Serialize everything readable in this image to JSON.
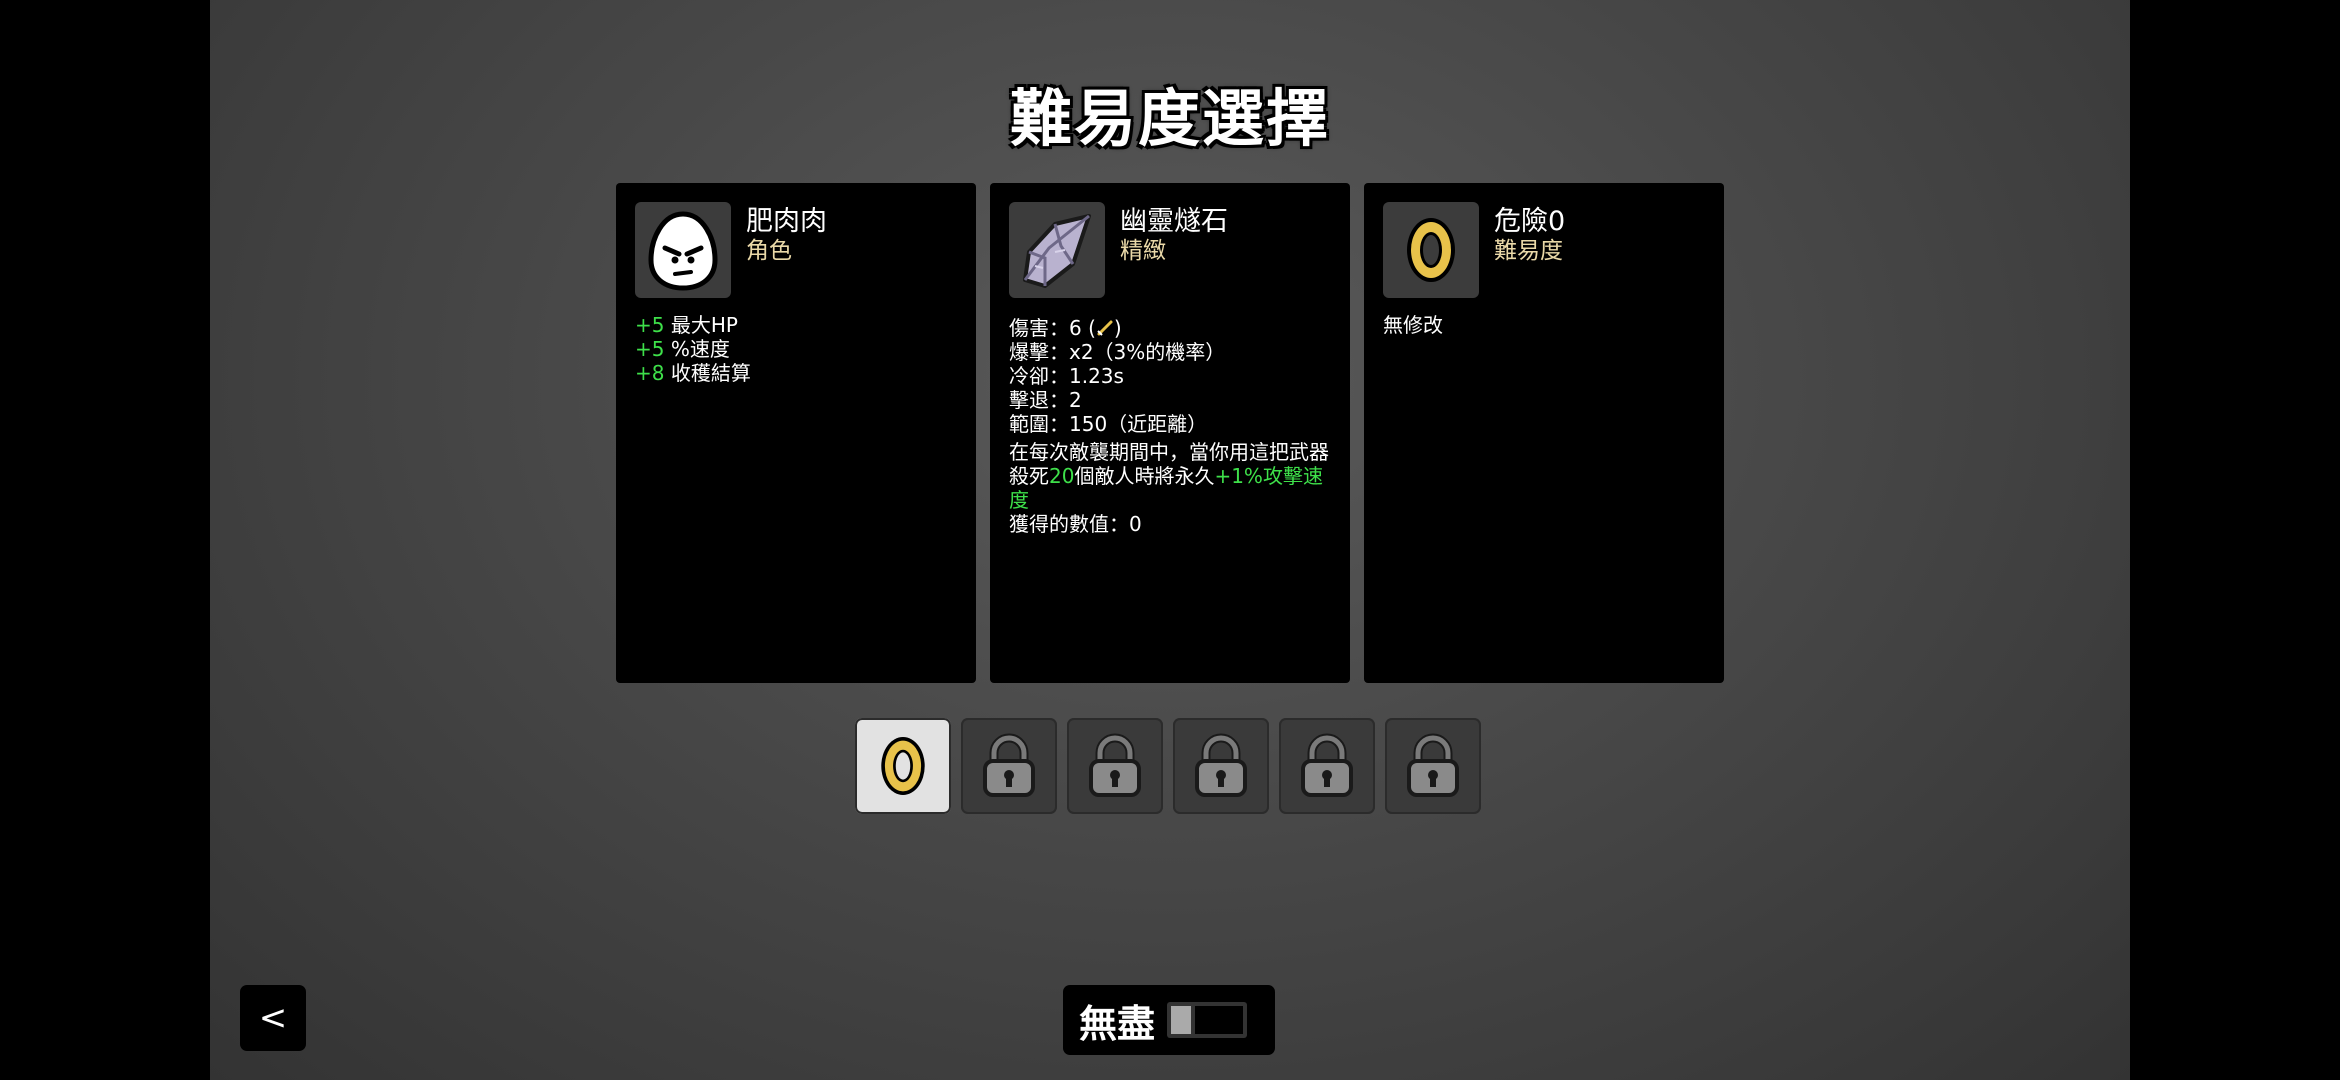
{
  "page_title": "難易度選擇",
  "cards": {
    "character": {
      "name": "肥肉肉",
      "type": "角色",
      "stats": [
        {
          "value": "+5",
          "label": "最大HP"
        },
        {
          "value": "+5",
          "label": "%速度"
        },
        {
          "value": "+8",
          "label": "收穫結算"
        }
      ]
    },
    "weapon": {
      "name": "幽靈燧石",
      "tier": "精緻",
      "damage": "傷害：6 (",
      "damage_close": ")",
      "crit": "爆擊：x2（3%的機率）",
      "cooldown": "冷卻：1.23s",
      "knockback": "擊退：2",
      "range": "範圍：150（近距離）",
      "effect_1": "在每次敵襲期間中，當你用這把武器",
      "effect_2a": "殺死",
      "effect_2b": "20",
      "effect_2c": "個敵人時將永久",
      "effect_2d": "+1%攻擊速度",
      "effect_3": "獲得的數值：0"
    },
    "difficulty": {
      "name": "危險0",
      "type": "難易度",
      "desc": "無修改"
    }
  },
  "danger_slots": [
    {
      "state": "selected",
      "icon": "danger-0-ring-icon"
    },
    {
      "state": "locked",
      "icon": "padlock-icon"
    },
    {
      "state": "locked",
      "icon": "padlock-icon"
    },
    {
      "state": "locked",
      "icon": "padlock-icon"
    },
    {
      "state": "locked",
      "icon": "padlock-icon"
    },
    {
      "state": "locked",
      "icon": "padlock-icon"
    }
  ],
  "back_label": "<",
  "endless": {
    "label": "無盡",
    "on": false
  },
  "colors": {
    "bonus_green": "#3ee04a",
    "subtitle_gold": "#ead9a8",
    "ring_gold": "#e8c24a"
  }
}
